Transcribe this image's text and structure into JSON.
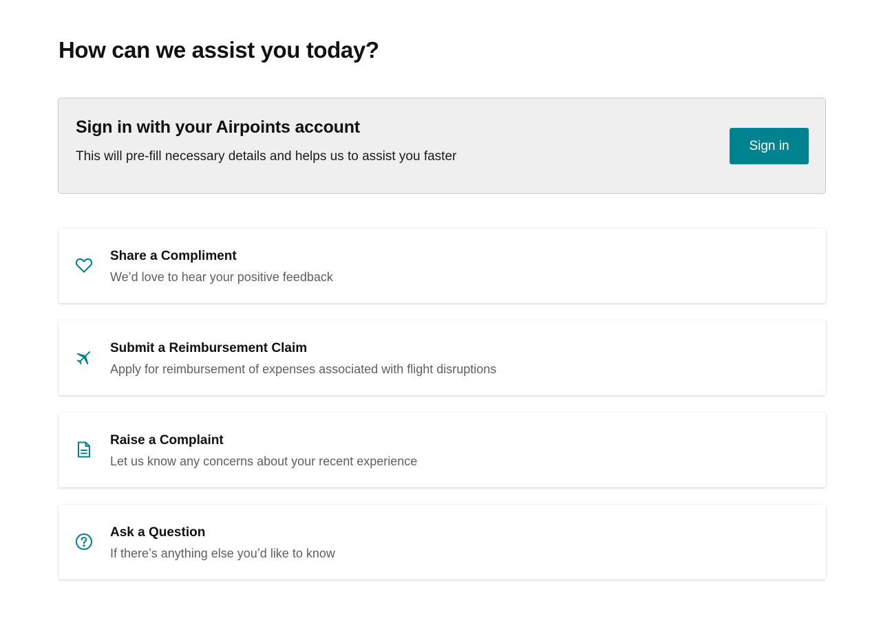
{
  "page": {
    "title": "How can we assist you today?"
  },
  "signin": {
    "title": "Sign in with your Airpoints account",
    "description": "This will pre-fill necessary details and helps us to assist you faster",
    "button_label": "Sign in"
  },
  "options": [
    {
      "icon": "heart-icon",
      "title": "Share a Compliment",
      "description": "We’d love to hear your positive feedback"
    },
    {
      "icon": "airplane-icon",
      "title": "Submit a Reimbursement Claim",
      "description": "Apply for reimbursement of expenses associated with flight disruptions"
    },
    {
      "icon": "document-icon",
      "title": "Raise a Complaint",
      "description": "Let us know any concerns about your recent experience"
    },
    {
      "icon": "question-circle-icon",
      "title": "Ask a Question",
      "description": "If there’s anything else you’d like to know"
    }
  ],
  "colors": {
    "accent": "#00838f",
    "panel_background": "#efefef",
    "muted_text": "#5f5f5f"
  }
}
